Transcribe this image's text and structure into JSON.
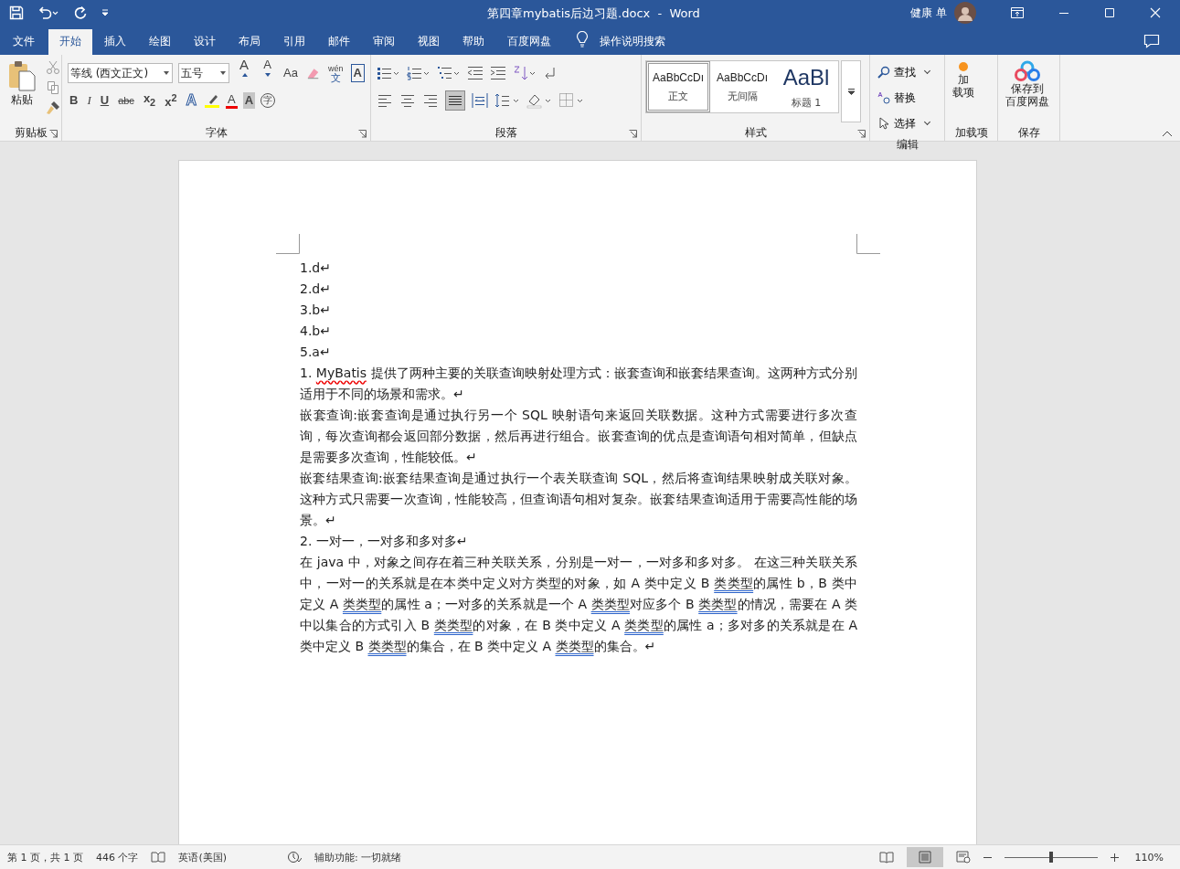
{
  "title_bar": {
    "title": "第四章mybatis后边习题.docx  -  Word",
    "user": "健康 单"
  },
  "tabs": [
    {
      "label": "文件",
      "selected": false
    },
    {
      "label": "开始",
      "selected": true
    },
    {
      "label": "插入",
      "selected": false
    },
    {
      "label": "绘图",
      "selected": false
    },
    {
      "label": "设计",
      "selected": false
    },
    {
      "label": "布局",
      "selected": false
    },
    {
      "label": "引用",
      "selected": false
    },
    {
      "label": "邮件",
      "selected": false
    },
    {
      "label": "审阅",
      "selected": false
    },
    {
      "label": "视图",
      "selected": false
    },
    {
      "label": "帮助",
      "selected": false
    },
    {
      "label": "百度网盘",
      "selected": false
    }
  ],
  "tell_me": "操作说明搜索",
  "ribbon": {
    "clipboard": {
      "paste": "粘贴",
      "group": "剪贴板"
    },
    "font": {
      "name": "等线 (西文正文)",
      "size": "五号",
      "grow": "A",
      "shrink": "A",
      "case": "Aa",
      "phonetic": "wén",
      "phonetic_base": "文",
      "border": "A",
      "bold": "B",
      "italic": "I",
      "underline": "U",
      "strike": "abc",
      "sub": "x$_{2}$",
      "sup": "x$^{2}$",
      "effects": "A",
      "font_color": "A",
      "shade": "A",
      "enclose": "字",
      "group": "字体"
    },
    "paragraph": {
      "group": "段落"
    },
    "styles": {
      "items": [
        {
          "kind": "body",
          "preview": "AaBbCcDı",
          "name": "正文",
          "selected": true
        },
        {
          "kind": "body",
          "preview": "AaBbCcDı",
          "name": "无间隔",
          "selected": false
        },
        {
          "kind": "heading",
          "preview": "AaBl",
          "name": "标题 1",
          "selected": false
        }
      ],
      "group": "样式"
    },
    "editing": {
      "find": "查找",
      "replace": "替换",
      "select": "选择",
      "group": "编辑"
    },
    "addins": {
      "lines": [
        "加",
        "载项"
      ],
      "group": "加载项"
    },
    "save": {
      "lines": [
        "保存到",
        "百度网盘"
      ],
      "group": "保存"
    }
  },
  "document": {
    "paragraphs": [
      {
        "runs": [
          {
            "text": "1.d↵"
          }
        ]
      },
      {
        "runs": [
          {
            "text": "2.d↵"
          }
        ]
      },
      {
        "runs": [
          {
            "text": "3.b↵"
          }
        ]
      },
      {
        "runs": [
          {
            "text": "4.b↵"
          }
        ]
      },
      {
        "runs": [
          {
            "text": "5.a↵"
          }
        ]
      },
      {
        "runs": [
          {
            "text": "1. "
          },
          {
            "text": "MyBatis",
            "kind": "spelling_error"
          },
          {
            "text": " 提供了两种主要的关联查询映射处理方式：嵌套查询和嵌套结果查询。这两种方式分别适用于不同的场景和需求。↵"
          }
        ]
      },
      {
        "runs": [
          {
            "text": "嵌套查询:嵌套查询是通过执行另一个 SQL 映射语句来返回关联数据。这种方式需要进行多次查询，每次查询都会返回部分数据，然后再进行组合。嵌套查询的优点是查询语句相对简单，但缺点是需要多次查询，性能较低。↵"
          }
        ]
      },
      {
        "runs": [
          {
            "text": "嵌套结果查询:嵌套结果查询是通过执行一个表关联查询 SQL，然后将查询结果映射成关联对象。这种方式只需要一次查询，性能较高，但查询语句相对复杂。嵌套结果查询适用于需要高性能的场景。↵"
          }
        ]
      },
      {
        "runs": [
          {
            "text": "2. 一对一，一对多和多对多↵"
          }
        ]
      },
      {
        "runs": [
          {
            "text": "在 java 中，对象之间存在着三种关联关系，分别是一对一，一对多和多对多。 在这三种关联关系中，一对一的关系就是在本类中定义对方类型的对象，如 A 类中定义 B "
          },
          {
            "text": "类类型",
            "kind": "grammar_error"
          },
          {
            "text": "的属性 b，B 类中定义 A "
          },
          {
            "text": "类类型",
            "kind": "grammar_error"
          },
          {
            "text": "的属性 a；一对多的关系就是一个 A "
          },
          {
            "text": "类类型",
            "kind": "grammar_error"
          },
          {
            "text": "对应多个 B "
          },
          {
            "text": "类类型",
            "kind": "grammar_error"
          },
          {
            "text": "的情况，需要在 A 类中以集合的方式引入 B "
          },
          {
            "text": "类类型",
            "kind": "grammar_error"
          },
          {
            "text": "的对象，在 B 类中定义 A "
          },
          {
            "text": "类类型",
            "kind": "grammar_error"
          },
          {
            "text": "的属性 a；多对多的关系就是在 A 类中定义 B "
          },
          {
            "text": "类类型",
            "kind": "grammar_error"
          },
          {
            "text": "的集合，在 B 类中定义 A "
          },
          {
            "text": "类类型",
            "kind": "grammar_error"
          },
          {
            "text": "的集合。↵"
          }
        ]
      }
    ]
  },
  "status_bar": {
    "page": "第 1 页，共 1 页",
    "words": "446 个字",
    "language": "英语(美国)",
    "accessibility": "辅助功能: 一切就绪",
    "zoom": "110%",
    "zoom_slider": {
      "level": 0.5
    }
  }
}
